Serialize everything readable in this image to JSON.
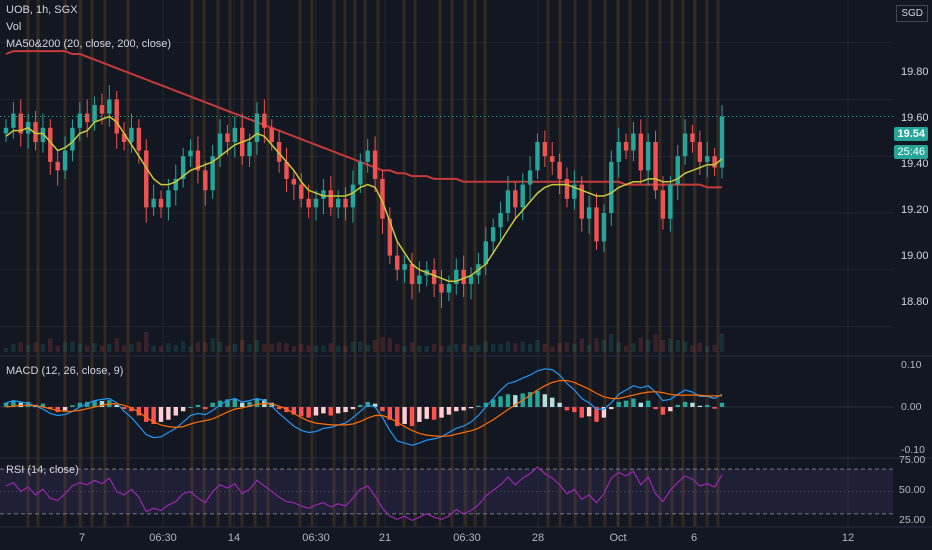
{
  "header": {
    "symbol_line": "UOB, 1h, SGX",
    "vol_label": "Vol",
    "ma_label": "MA50&200 (20, close, 200, close)"
  },
  "currency_button": "SGD",
  "price_badge": {
    "value": "19.54",
    "countdown": "25:46",
    "color": "#26a69a"
  },
  "macd": {
    "label": "MACD (12, 26, close, 9)",
    "ticks": [
      "0.10",
      "0.00",
      "-0.10"
    ]
  },
  "rsi": {
    "label": "RSI (14, close)",
    "ticks": [
      "75.00",
      "50.00",
      "25.00"
    ]
  },
  "price_ticks": [
    "19.80",
    "19.60",
    "19.40",
    "19.20",
    "19.00",
    "18.80"
  ],
  "x_ticks": [
    "7",
    "06:30",
    "14",
    "06:30",
    "21",
    "06:30",
    "28",
    "Oct",
    "6",
    "12"
  ],
  "colors": {
    "up": "#26a69a",
    "down": "#ef5350",
    "ma20": "#c9c93a",
    "ma200": "#c63a3a",
    "macd": "#2196f3",
    "signal": "#ff6d00",
    "rsi": "#9c27b0",
    "session": "#8a5a1e"
  },
  "chart_data": {
    "type": "candlestick",
    "symbol": "UOB",
    "interval": "1h",
    "exchange": "SGX",
    "ylim": [
      18.7,
      19.95
    ],
    "close": [
      19.5,
      19.55,
      19.48,
      19.52,
      19.45,
      19.5,
      19.38,
      19.35,
      19.42,
      19.5,
      19.55,
      19.52,
      19.58,
      19.55,
      19.6,
      19.48,
      19.45,
      19.5,
      19.42,
      19.22,
      19.25,
      19.22,
      19.28,
      19.32,
      19.4,
      19.42,
      19.35,
      19.28,
      19.4,
      19.48,
      19.45,
      19.5,
      19.4,
      19.45,
      19.55,
      19.5,
      19.45,
      19.38,
      19.32,
      19.3,
      19.25,
      19.22,
      19.25,
      19.28,
      19.22,
      19.25,
      19.22,
      19.3,
      19.38,
      19.42,
      19.32,
      19.18,
      19.05,
      19.0,
      19.02,
      18.95,
      18.98,
      19.0,
      18.95,
      18.92,
      18.95,
      19.0,
      18.95,
      18.98,
      19.02,
      19.1,
      19.15,
      19.2,
      19.28,
      19.22,
      19.3,
      19.35,
      19.45,
      19.4,
      19.38,
      19.32,
      19.25,
      19.3,
      19.18,
      19.22,
      19.1,
      19.2,
      19.38,
      19.45,
      19.42,
      19.48,
      19.35,
      19.45,
      19.28,
      19.18,
      19.3,
      19.4,
      19.48,
      19.45,
      19.38,
      19.4,
      19.36,
      19.54
    ],
    "ma20": [
      19.47,
      19.49,
      19.49,
      19.5,
      19.48,
      19.48,
      19.45,
      19.42,
      19.43,
      19.45,
      19.48,
      19.49,
      19.52,
      19.53,
      19.54,
      19.52,
      19.48,
      19.44,
      19.4,
      19.36,
      19.32,
      19.3,
      19.3,
      19.31,
      19.33,
      19.35,
      19.36,
      19.37,
      19.38,
      19.4,
      19.42,
      19.44,
      19.45,
      19.46,
      19.48,
      19.47,
      19.44,
      19.41,
      19.38,
      19.35,
      19.31,
      19.28,
      19.27,
      19.26,
      19.26,
      19.26,
      19.26,
      19.27,
      19.29,
      19.3,
      19.29,
      19.24,
      19.17,
      19.1,
      19.06,
      19.02,
      19.0,
      18.99,
      18.98,
      18.97,
      18.96,
      18.96,
      18.97,
      18.98,
      19.0,
      19.02,
      19.06,
      19.1,
      19.14,
      19.18,
      19.21,
      19.24,
      19.27,
      19.29,
      19.3,
      19.3,
      19.3,
      19.29,
      19.28,
      19.27,
      19.26,
      19.26,
      19.27,
      19.29,
      19.3,
      19.31,
      19.31,
      19.32,
      19.32,
      19.31,
      19.31,
      19.32,
      19.34,
      19.35,
      19.36,
      19.37,
      19.37,
      19.39
    ],
    "ma200": [
      19.76,
      19.77,
      19.77,
      19.77,
      19.77,
      19.77,
      19.77,
      19.77,
      19.77,
      19.76,
      19.76,
      19.75,
      19.74,
      19.73,
      19.72,
      19.71,
      19.7,
      19.69,
      19.68,
      19.67,
      19.66,
      19.65,
      19.64,
      19.63,
      19.62,
      19.61,
      19.6,
      19.59,
      19.58,
      19.57,
      19.56,
      19.55,
      19.54,
      19.53,
      19.52,
      19.51,
      19.5,
      19.49,
      19.48,
      19.47,
      19.46,
      19.45,
      19.44,
      19.43,
      19.42,
      19.41,
      19.4,
      19.39,
      19.38,
      19.37,
      19.36,
      19.35,
      19.35,
      19.34,
      19.34,
      19.33,
      19.33,
      19.33,
      19.32,
      19.32,
      19.32,
      19.32,
      19.31,
      19.31,
      19.31,
      19.31,
      19.31,
      19.31,
      19.31,
      19.31,
      19.31,
      19.31,
      19.31,
      19.31,
      19.31,
      19.31,
      19.31,
      19.31,
      19.31,
      19.31,
      19.31,
      19.31,
      19.31,
      19.31,
      19.3,
      19.3,
      19.3,
      19.3,
      19.3,
      19.3,
      19.3,
      19.3,
      19.3,
      19.3,
      19.3,
      19.29,
      19.29,
      19.29
    ],
    "macd_ylim": [
      -0.12,
      0.12
    ],
    "macd_hist": [
      0.01,
      0.015,
      0.01,
      0.012,
      0.005,
      0.008,
      -0.005,
      -0.012,
      -0.008,
      0.004,
      0.01,
      0.012,
      0.015,
      0.014,
      0.016,
      0.005,
      -0.005,
      -0.01,
      -0.02,
      -0.035,
      -0.04,
      -0.035,
      -0.03,
      -0.02,
      -0.01,
      0.0,
      0.005,
      -0.005,
      0.01,
      0.015,
      0.018,
      0.02,
      0.01,
      0.012,
      0.02,
      0.018,
      0.01,
      -0.005,
      -0.012,
      -0.018,
      -0.022,
      -0.025,
      -0.02,
      -0.015,
      -0.02,
      -0.015,
      -0.012,
      -0.005,
      0.005,
      0.012,
      0.008,
      -0.01,
      -0.03,
      -0.045,
      -0.04,
      -0.045,
      -0.035,
      -0.028,
      -0.03,
      -0.025,
      -0.018,
      -0.01,
      -0.008,
      -0.003,
      0.003,
      0.01,
      0.018,
      0.025,
      0.03,
      0.028,
      0.032,
      0.035,
      0.038,
      0.03,
      0.022,
      0.01,
      -0.008,
      -0.012,
      -0.025,
      -0.022,
      -0.035,
      -0.025,
      -0.005,
      0.012,
      0.015,
      0.02,
      0.01,
      0.015,
      -0.005,
      -0.018,
      -0.01,
      0.005,
      0.012,
      0.01,
      0.003,
      0.005,
      -0.004,
      0.01
    ],
    "macd_line": [
      0.01,
      0.015,
      0.012,
      0.008,
      0.002,
      -0.005,
      -0.015,
      -0.02,
      -0.018,
      -0.01,
      0.0,
      0.008,
      0.015,
      0.018,
      0.02,
      0.01,
      -0.01,
      -0.025,
      -0.045,
      -0.065,
      -0.072,
      -0.07,
      -0.06,
      -0.05,
      -0.035,
      -0.02,
      -0.015,
      -0.018,
      -0.008,
      0.005,
      0.015,
      0.02,
      0.012,
      0.015,
      0.02,
      0.015,
      0.002,
      -0.015,
      -0.03,
      -0.045,
      -0.055,
      -0.06,
      -0.058,
      -0.05,
      -0.048,
      -0.042,
      -0.038,
      -0.025,
      -0.01,
      0.005,
      0.0,
      -0.025,
      -0.055,
      -0.08,
      -0.085,
      -0.09,
      -0.085,
      -0.078,
      -0.075,
      -0.07,
      -0.06,
      -0.05,
      -0.045,
      -0.035,
      -0.02,
      0.0,
      0.02,
      0.04,
      0.055,
      0.06,
      0.068,
      0.075,
      0.085,
      0.09,
      0.088,
      0.075,
      0.055,
      0.04,
      0.02,
      0.01,
      -0.005,
      -0.005,
      0.01,
      0.03,
      0.04,
      0.05,
      0.045,
      0.05,
      0.035,
      0.015,
      0.018,
      0.03,
      0.04,
      0.035,
      0.025,
      0.025,
      0.02,
      0.03
    ],
    "signal_line": [
      0.0,
      0.002,
      0.004,
      0.004,
      0.003,
      0.0,
      -0.004,
      -0.008,
      -0.01,
      -0.01,
      -0.008,
      -0.004,
      0.0,
      0.004,
      0.007,
      0.008,
      0.004,
      -0.002,
      -0.012,
      -0.025,
      -0.035,
      -0.042,
      -0.046,
      -0.048,
      -0.046,
      -0.04,
      -0.035,
      -0.032,
      -0.028,
      -0.02,
      -0.012,
      -0.005,
      -0.002,
      0.002,
      0.006,
      0.008,
      0.007,
      0.002,
      -0.005,
      -0.015,
      -0.025,
      -0.033,
      -0.038,
      -0.04,
      -0.042,
      -0.042,
      -0.042,
      -0.04,
      -0.034,
      -0.026,
      -0.02,
      -0.02,
      -0.026,
      -0.036,
      -0.046,
      -0.055,
      -0.062,
      -0.066,
      -0.068,
      -0.069,
      -0.068,
      -0.064,
      -0.06,
      -0.056,
      -0.05,
      -0.04,
      -0.03,
      -0.018,
      -0.006,
      0.005,
      0.016,
      0.028,
      0.04,
      0.05,
      0.058,
      0.062,
      0.062,
      0.058,
      0.05,
      0.042,
      0.032,
      0.024,
      0.02,
      0.02,
      0.024,
      0.028,
      0.032,
      0.035,
      0.036,
      0.034,
      0.03,
      0.028,
      0.028,
      0.028,
      0.028,
      0.026,
      0.026,
      0.026
    ],
    "rsi_ylim": [
      20,
      80
    ],
    "rsi_levels": [
      70,
      30
    ],
    "rsi": [
      55,
      58,
      50,
      54,
      47,
      52,
      44,
      42,
      48,
      55,
      58,
      56,
      60,
      57,
      62,
      50,
      47,
      52,
      45,
      32,
      35,
      33,
      38,
      41,
      48,
      50,
      44,
      40,
      50,
      56,
      53,
      57,
      48,
      52,
      60,
      55,
      50,
      45,
      41,
      40,
      37,
      35,
      38,
      40,
      36,
      39,
      37,
      44,
      52,
      55,
      46,
      35,
      28,
      25,
      28,
      24,
      27,
      30,
      27,
      25,
      28,
      34,
      30,
      33,
      38,
      46,
      51,
      56,
      63,
      56,
      62,
      66,
      72,
      66,
      62,
      56,
      48,
      52,
      43,
      47,
      40,
      48,
      62,
      67,
      64,
      68,
      56,
      63,
      48,
      41,
      51,
      58,
      64,
      61,
      55,
      57,
      54,
      65
    ],
    "session_bars": [
      28,
      38,
      65,
      80,
      92,
      105,
      128,
      192,
      204,
      218,
      230,
      242,
      255,
      268,
      300,
      312,
      334,
      345,
      355,
      365,
      378,
      404,
      415,
      440,
      452,
      465,
      475,
      485,
      548,
      560,
      575,
      590,
      605,
      618,
      630,
      647,
      660,
      672,
      683,
      695,
      707,
      718
    ]
  }
}
